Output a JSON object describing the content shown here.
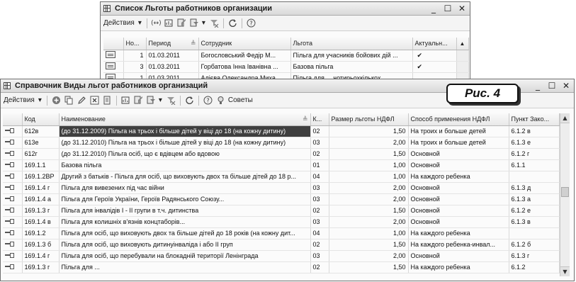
{
  "back_window": {
    "title": "Список Льготы работников организации",
    "actions_label": "Действия",
    "columns": [
      "Но...",
      "Период",
      "Сотрудник",
      "Льгота",
      "Актуальн..."
    ],
    "rows": [
      {
        "num": "1",
        "period": "01.03.2011",
        "employee": "Богословський Федір М...",
        "benefit": "Пільга для учасників бойових дій ...",
        "actual": "✔"
      },
      {
        "num": "3",
        "period": "01.03.2011",
        "employee": "Горбатова Інна Іванівна ...",
        "benefit": "Базова пільга",
        "actual": "✔"
      },
      {
        "num": "1",
        "period": "01.03.2011",
        "employee": "Алієва Олександра Миха...",
        "benefit": "Пільга для ... чотирьохкількох",
        "actual": ""
      }
    ]
  },
  "front_window": {
    "title": "Справочник Виды льгот работников организаций",
    "actions_label": "Действия",
    "tips_label": "Советы",
    "columns": [
      "Код",
      "Наименование",
      "К...",
      "Размер льготы НДФЛ",
      "Способ применения НДФЛ",
      "Пункт Зако..."
    ],
    "rows": [
      {
        "code": "612в",
        "name": "(до 31.12.2009) Пільга на трьох і більше дітей у віці до 18 (на кожну дитину)",
        "k": "02",
        "amount": "1,50",
        "method": "На троих и больше детей",
        "point": "6.1.2 в"
      },
      {
        "code": "613е",
        "name": "(до 31.12.2010) Пільга на трьох і більше дітей у віці до 18 (на кожну дитину)",
        "k": "03",
        "amount": "2,00",
        "method": "На троих и больше детей",
        "point": "6.1.3 е"
      },
      {
        "code": "612г",
        "name": "(до 31.12.2010) Пільга осіб, що є вдівцем або вдовою",
        "k": "02",
        "amount": "1,50",
        "method": "Основной",
        "point": "6.1.2 г"
      },
      {
        "code": "169.1.1",
        "name": "Базова пільга",
        "k": "01",
        "amount": "1,00",
        "method": "Основной",
        "point": "6.1.1"
      },
      {
        "code": "169.1.2ВР",
        "name": "Другий з батьків - Пільга для осіб, що виховують двох та більше дітей до 18 р...",
        "k": "04",
        "amount": "1,00",
        "method": "На каждого ребенка",
        "point": ""
      },
      {
        "code": "169.1.4 г",
        "name": "Пільга для вивезених під час війни",
        "k": "03",
        "amount": "2,00",
        "method": "Основной",
        "point": "6.1.3 д"
      },
      {
        "code": "169.1.4 а",
        "name": "Пільга для Героїв України, Героїв Радянського Союзу...",
        "k": "03",
        "amount": "2,00",
        "method": "Основной",
        "point": "6.1.3 а"
      },
      {
        "code": "169.1.3 г",
        "name": "Пільга для інвалідів I - II групи в т.ч. дитинства",
        "k": "02",
        "amount": "1,50",
        "method": "Основной",
        "point": "6.1.2 е"
      },
      {
        "code": "169.1.4 в",
        "name": "Пільга для колишніх в'язнів концтаборів...",
        "k": "03",
        "amount": "2,00",
        "method": "Основной",
        "point": "6.1.3 в"
      },
      {
        "code": "169.1.2",
        "name": "Пільга для осіб, що виховують двох та більше дітей до 18 років (на кожну дит...",
        "k": "04",
        "amount": "1,00",
        "method": "На каждого ребенка",
        "point": ""
      },
      {
        "code": "169.1.3 б",
        "name": "Пільга для осіб, що виховують дитинуінваліда і або II груп",
        "k": "02",
        "amount": "1,50",
        "method": "На каждого ребенка-инвал...",
        "point": "6.1.2 б"
      },
      {
        "code": "169.1.4 г",
        "name": "Пільга для осіб, що перебували на блокадній території Ленінграда",
        "k": "03",
        "amount": "2,00",
        "method": "Основной",
        "point": "6.1.3 г"
      },
      {
        "code": "169.1.3 г",
        "name": "Пільга для ...",
        "k": "02",
        "amount": "1,50",
        "method": "На каждого ребенка",
        "point": "6.1.2"
      }
    ]
  },
  "figure_label": "Рис. 4"
}
